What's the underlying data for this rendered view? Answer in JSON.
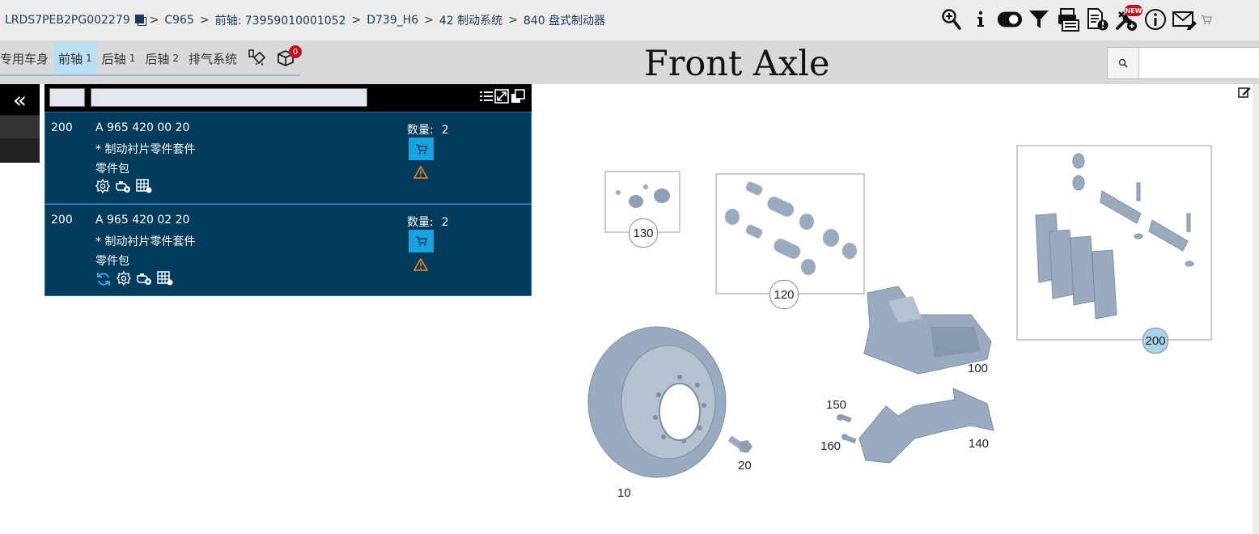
{
  "breadcrumb": {
    "vin": "LRDS7PEB2PG002279",
    "items": [
      "C965",
      "前轴: 73959010001052",
      "D739_H6",
      "42 制动系统",
      "840 盘式制动器"
    ],
    "separator": ">"
  },
  "toolbar": {
    "icons": [
      "zoom-in-icon",
      "info-icon",
      "toggle-icon",
      "filter-icon",
      "print-list-icon",
      "document-alert-icon",
      "tools-new-icon",
      "info-circle-icon",
      "mail-edit-icon",
      "cart-icon"
    ],
    "new_badge": "NEW"
  },
  "tabs": [
    {
      "label": "专用车身",
      "count": ""
    },
    {
      "label": "前轴",
      "count": "1",
      "active": true
    },
    {
      "label": "后轴",
      "count": "1"
    },
    {
      "label": "后轴",
      "count": "2"
    },
    {
      "label": "排气系统",
      "count": ""
    }
  ],
  "cart_count": "0",
  "page_title": "Front Axle",
  "search": {
    "placeholder": ""
  },
  "parts": [
    {
      "pos": "200",
      "number": "A 965 420 00 20",
      "desc": "* 制动衬片零件套件",
      "type": "零件包",
      "qty_label": "数量:",
      "qty": "2",
      "icons": [
        "gear-info-icon",
        "engine-icon",
        "table-icon"
      ]
    },
    {
      "pos": "200",
      "number": "A 965 420 02 20",
      "desc": "* 制动衬片零件套件",
      "type": "零件包",
      "qty_label": "数量:",
      "qty": "2",
      "icons": [
        "refresh-icon",
        "gear-info-icon",
        "engine-icon",
        "table-icon"
      ]
    }
  ],
  "diagram": {
    "callouts": [
      "130",
      "120",
      "200",
      "100",
      "150",
      "160",
      "140",
      "20",
      "10"
    ],
    "highlighted": "200"
  },
  "colors": {
    "row_bg": "#003b5c",
    "accent": "#18a3e0",
    "tab_active": "#b9dff2",
    "badge": "#c20e1a",
    "part_fill": "#9aabbf"
  }
}
